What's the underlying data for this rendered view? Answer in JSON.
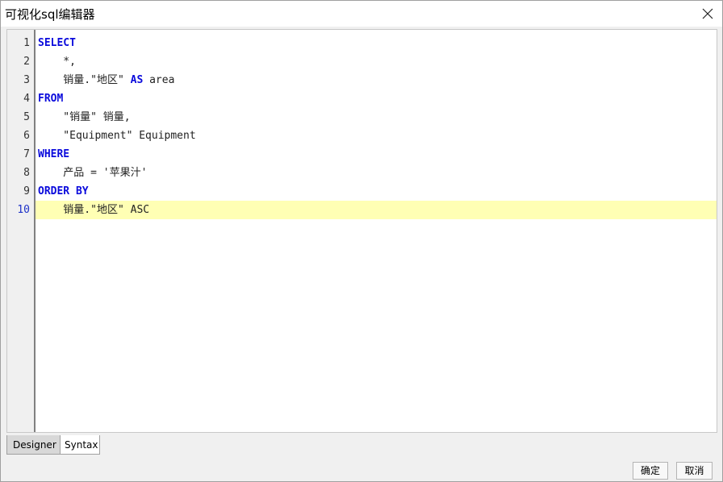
{
  "window": {
    "title": "可视化sql编辑器"
  },
  "editor": {
    "current_line": 10,
    "lines": [
      {
        "number": "1",
        "tokens": [
          {
            "text": "SELECT",
            "kw": true
          }
        ]
      },
      {
        "number": "2",
        "tokens": [
          {
            "text": "    *,",
            "kw": false
          }
        ]
      },
      {
        "number": "3",
        "tokens": [
          {
            "text": "    销量.\"地区\" ",
            "kw": false
          },
          {
            "text": "AS",
            "kw": true
          },
          {
            "text": " area",
            "kw": false
          }
        ]
      },
      {
        "number": "4",
        "tokens": [
          {
            "text": "FROM",
            "kw": true
          }
        ]
      },
      {
        "number": "5",
        "tokens": [
          {
            "text": "    \"销量\" 销量,",
            "kw": false
          }
        ]
      },
      {
        "number": "6",
        "tokens": [
          {
            "text": "    \"Equipment\" Equipment",
            "kw": false
          }
        ]
      },
      {
        "number": "7",
        "tokens": [
          {
            "text": "WHERE",
            "kw": true
          }
        ]
      },
      {
        "number": "8",
        "tokens": [
          {
            "text": "    产品 = '苹果汁'",
            "kw": false
          }
        ]
      },
      {
        "number": "9",
        "tokens": [
          {
            "text": "ORDER BY",
            "kw": true
          }
        ]
      },
      {
        "number": "10",
        "tokens": [
          {
            "text": "    销量.\"地区\" ASC",
            "kw": false
          }
        ]
      }
    ]
  },
  "tabs": {
    "designer": "Designer",
    "syntax": "Syntax",
    "active": "Syntax"
  },
  "buttons": {
    "ok": "确定",
    "cancel": "取消"
  },
  "colors": {
    "keyword": "#0a0adc",
    "current_line_bg": "#ffffb4",
    "active_line_number": "#1e32c8"
  }
}
